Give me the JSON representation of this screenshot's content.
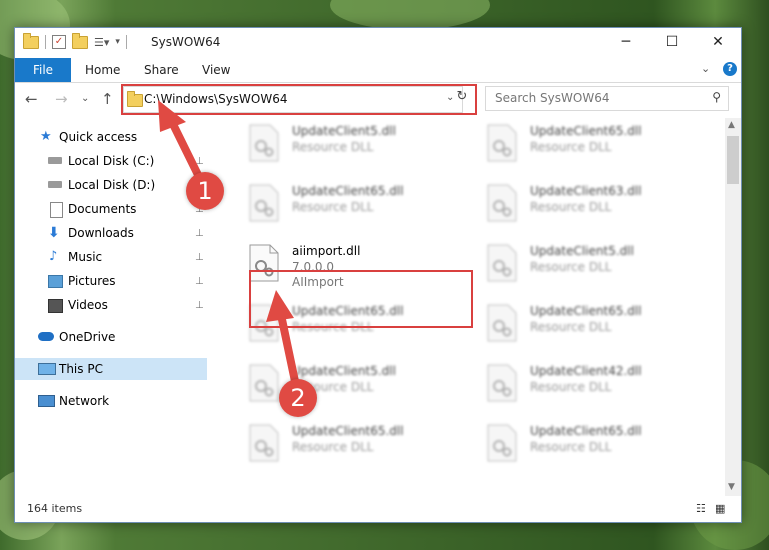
{
  "window": {
    "title": "SysWOW64",
    "minimize_glyph": "─",
    "maximize_glyph": "☐",
    "close_glyph": "✕"
  },
  "ribbon": {
    "file_label": "File",
    "tabs": [
      "Home",
      "Share",
      "View"
    ],
    "expand_glyph": "⌄",
    "help_glyph": "?"
  },
  "navigation": {
    "back_glyph": "←",
    "forward_glyph": "→",
    "recent_glyph": "⌄",
    "up_glyph": "↑",
    "address": "C:\\Windows\\SysWOW64",
    "refresh_glyph": "↻",
    "search_placeholder": "Search SysWOW64"
  },
  "sidebar": {
    "items": [
      {
        "label": "Quick access",
        "icon": "star-icon"
      },
      {
        "label": "Local Disk (C:)",
        "icon": "drive-icon",
        "pinned": true
      },
      {
        "label": "Local Disk (D:)",
        "icon": "drive-icon",
        "pinned": true
      },
      {
        "label": "Documents",
        "icon": "documents-icon",
        "pinned": true
      },
      {
        "label": "Downloads",
        "icon": "download-icon",
        "pinned": true
      },
      {
        "label": "Music",
        "icon": "music-icon",
        "pinned": true
      },
      {
        "label": "Pictures",
        "icon": "pictures-icon",
        "pinned": true
      },
      {
        "label": "Videos",
        "icon": "videos-icon",
        "pinned": true
      },
      {
        "label": "OneDrive",
        "icon": "cloud-icon"
      },
      {
        "label": "This PC",
        "icon": "computer-icon",
        "selected": true
      },
      {
        "label": "Network",
        "icon": "network-icon"
      }
    ],
    "pin_glyph": "📌"
  },
  "files": [
    {
      "name": "UpdateClient5.dll",
      "type": "Resource DLL"
    },
    {
      "name": "UpdateClient65.dll",
      "type": "Resource DLL"
    },
    {
      "name": "UpdateClient65.dll",
      "type": "Resource DLL"
    },
    {
      "name": "UpdateClient63.dll",
      "type": "Resource DLL"
    },
    {
      "name": "aiimport.dll",
      "version": "7.0.0.0",
      "type": "AIImport",
      "highlighted": true
    },
    {
      "name": "UpdateClient5.dll",
      "type": "Resource DLL"
    },
    {
      "name": "UpdateClient65.dll",
      "type": "Resource DLL"
    },
    {
      "name": "UpdateClient65.dll",
      "type": "Resource DLL"
    },
    {
      "name": "UpdateClient5.dll",
      "type": "Resource DLL"
    },
    {
      "name": "UpdateClient42.dll",
      "type": "Resource DLL"
    },
    {
      "name": "UpdateClient65.dll",
      "type": "Resource DLL"
    },
    {
      "name": "UpdateClient65.dll",
      "type": "Resource DLL"
    }
  ],
  "status": {
    "item_count": "164 items"
  },
  "annotations": [
    {
      "number": "1",
      "color": "#e04a43"
    },
    {
      "number": "2",
      "color": "#e04a43"
    }
  ]
}
